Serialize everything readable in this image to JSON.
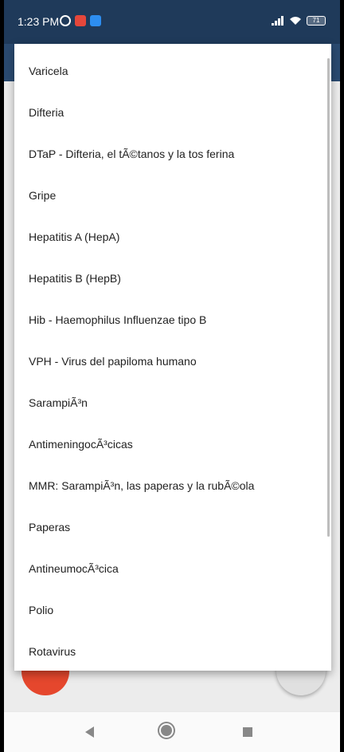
{
  "status_bar": {
    "time": "1:23 PM",
    "icons_left": [
      "alarm-icon",
      "app-red-icon",
      "app-blue-icon"
    ],
    "icons_right": [
      "signal-icon",
      "wifi-icon",
      "battery-icon"
    ],
    "battery": "71"
  },
  "colors": {
    "status_bar": "#1f3a5a",
    "app_bar": "#2a4a70",
    "fab_left": "#e5472d"
  },
  "dropdown": {
    "items": [
      "Varicela",
      "Difteria",
      "DTaP - Difteria, el tÃ©tanos y la tos ferina",
      "Gripe",
      "Hepatitis A (HepA)",
      "Hepatitis B (HepB)",
      "Hib - Haemophilus Influenzae tipo B",
      "VPH - Virus del papiloma humano",
      "SarampiÃ³n",
      "AntimeningocÃ³cicas",
      "MMR: SarampiÃ³n, las paperas y la rubÃ©ola",
      "Paperas",
      "AntineumocÃ³cica",
      "Polio",
      "Rotavirus"
    ]
  },
  "nav_bar": {
    "icons": [
      "back-icon",
      "home-icon",
      "recents-icon"
    ]
  }
}
